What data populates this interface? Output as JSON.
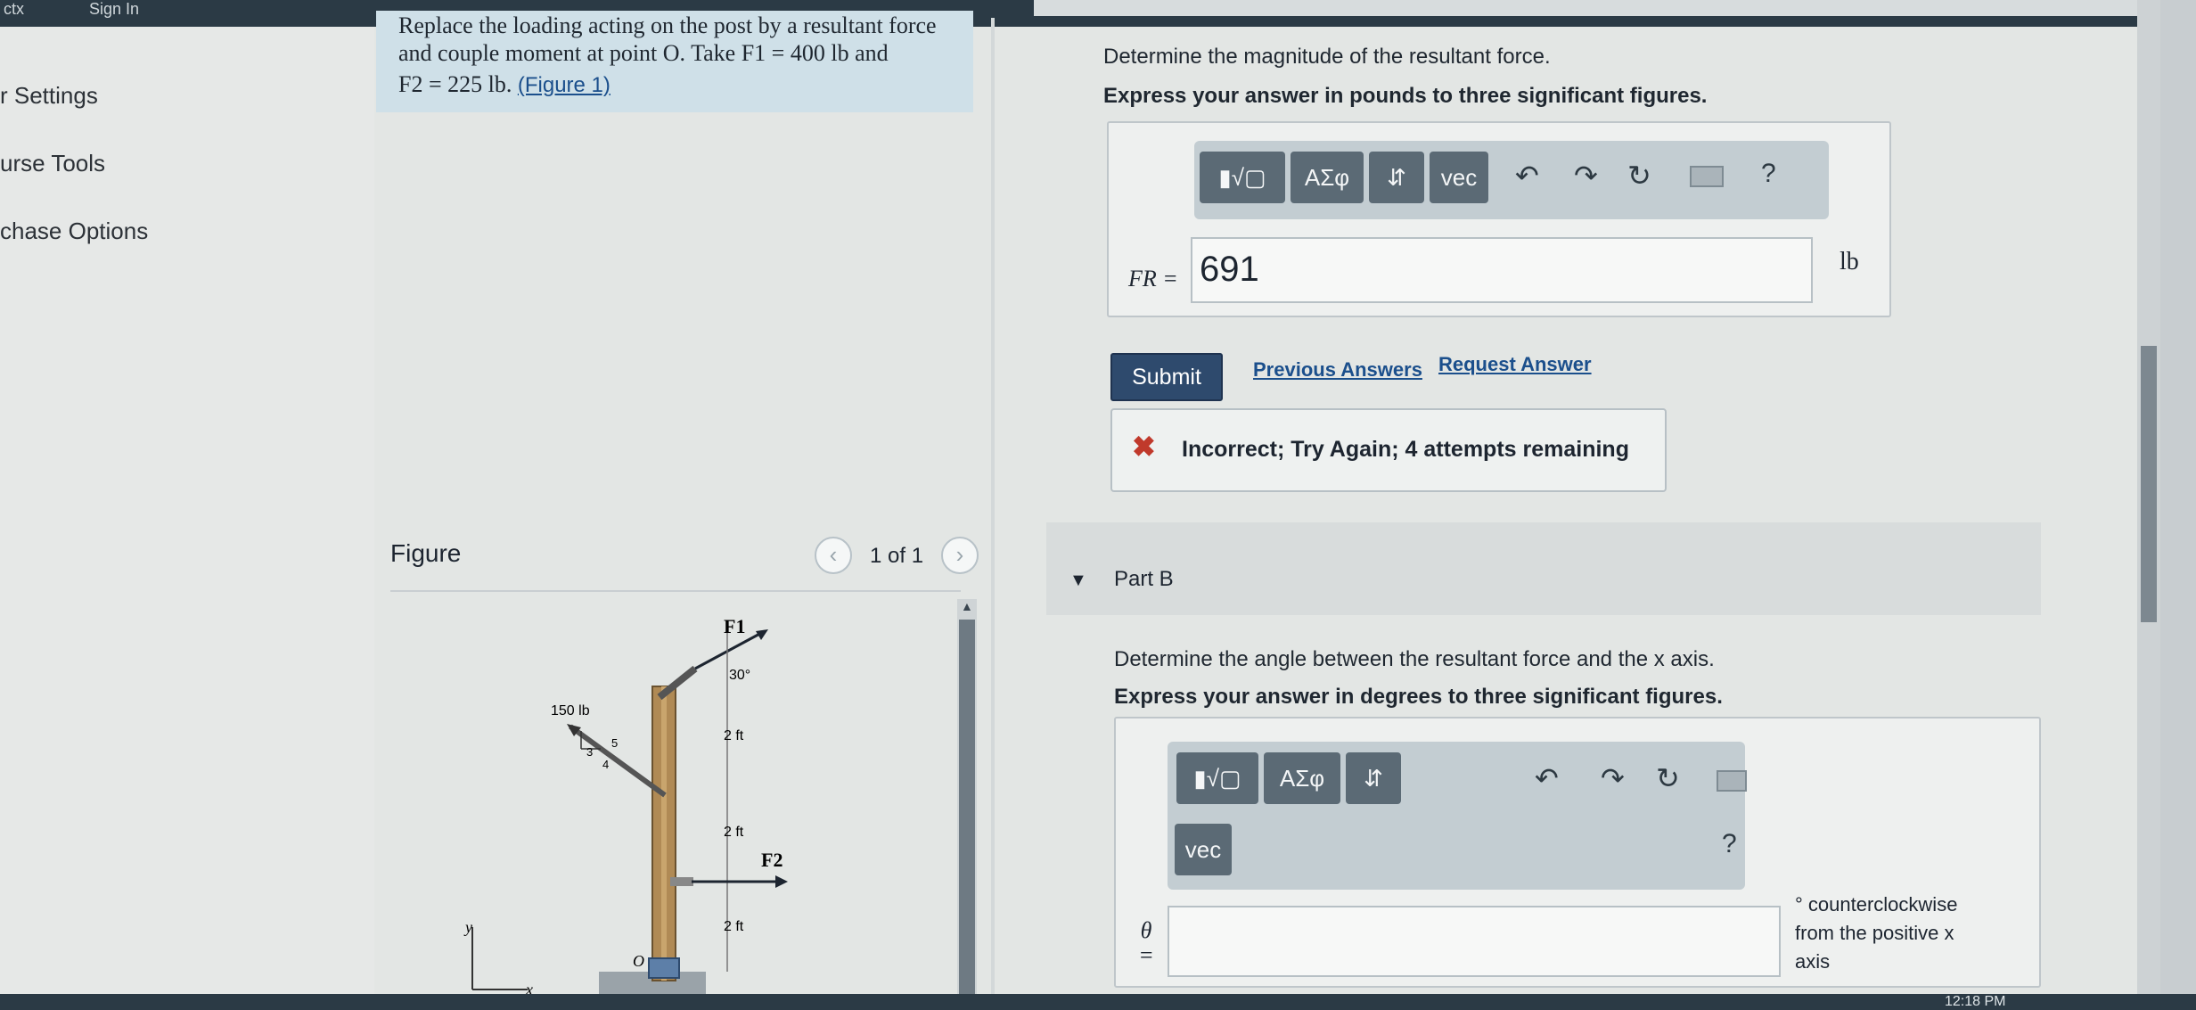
{
  "topbar": {
    "item_left": "ctx",
    "item_signin": "Sign In"
  },
  "sidebar": {
    "items": [
      "r Settings",
      "urse Tools",
      "chase Options"
    ]
  },
  "problem": {
    "line1": "Replace the loading acting on the post by a resultant force",
    "line2": "and couple moment at point O. Take F1 = 400 lb and",
    "line3": "F2 = 225 lb.",
    "figure_link": "(Figure 1)"
  },
  "figure": {
    "heading": "Figure",
    "pager": "1 of 1",
    "labels": {
      "f1": "F1",
      "f2": "F2",
      "angle": "30°",
      "load": "150 lb",
      "tri_5": "5",
      "tri_3": "3",
      "tri_4": "4",
      "dim1": "2 ft",
      "dim2": "2 ft",
      "dim3": "2 ft",
      "origin": "O",
      "axis_y": "y",
      "axis_x": "x"
    }
  },
  "part_a": {
    "question": "Determine the magnitude of the resultant force.",
    "instruction": "Express your answer in pounds to three significant figures.",
    "toolbar": {
      "templates": "▮√▢",
      "greek": "ΑΣφ",
      "arrows": "⇵",
      "vec": "vec",
      "help": "?"
    },
    "var_label": "FR =",
    "answer_value": "691",
    "unit": "lb",
    "submit_label": "Submit",
    "previous_answers": "Previous Answers",
    "request_answer": "Request Answer",
    "feedback": "Incorrect; Try Again; 4 attempts remaining"
  },
  "part_b": {
    "title": "Part B",
    "question": "Determine the angle between the resultant force and the x axis.",
    "instruction": "Express your answer in degrees to three significant figures.",
    "toolbar": {
      "templates": "▮√▢",
      "greek": "ΑΣφ",
      "arrows": "⇵",
      "vec": "vec",
      "help": "?"
    },
    "var_label": "θ =",
    "answer_value": "",
    "unit_line1": "° counterclockwise",
    "unit_line2": "from the positive x",
    "unit_line3": "axis"
  },
  "taskbar": {
    "clock": "12:18 PM"
  },
  "colors": {
    "accent": "#2e4a6d",
    "toolbar_btn": "#5b6a75",
    "error": "#c0392b",
    "link": "#1b4f8c"
  }
}
